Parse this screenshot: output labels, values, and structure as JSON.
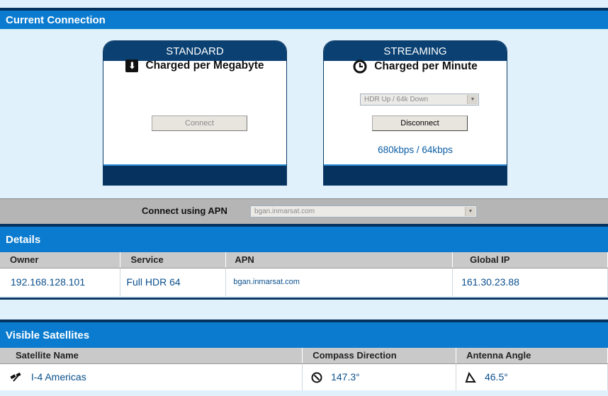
{
  "current_connection": {
    "title": "Current Connection",
    "standard": {
      "title": "STANDARD",
      "icon": "download-arrow-icon",
      "charge_label": "Charged per Megabyte",
      "connect_label": "Connect"
    },
    "streaming": {
      "title": "STREAMING",
      "icon": "clock-icon",
      "charge_label": "Charged per Minute",
      "rate_select": "HDR Up / 64k Down",
      "disconnect_label": "Disconnect",
      "rate_text": "680kbps / 64kbps"
    },
    "apn": {
      "label": "Connect using APN",
      "value": "bgan.inmarsat.com"
    }
  },
  "details": {
    "title": "Details",
    "columns": [
      "Owner",
      "Service",
      "APN",
      "Global IP"
    ],
    "row": {
      "owner": "192.168.128.101",
      "service": "Full HDR 64",
      "apn": "bgan.inmarsat.com",
      "global_ip": "161.30.23.88"
    }
  },
  "satellites": {
    "title": "Visible Satellites",
    "columns": [
      "Satellite Name",
      "Compass Direction",
      "Antenna Angle"
    ],
    "row": {
      "name": "I-4 Americas",
      "compass": "147.3°",
      "angle": "46.5°"
    }
  },
  "colors": {
    "header_blue": "#0a7bcf",
    "card_navy": "#0a4072",
    "value_blue": "#0a4f8c",
    "background": "#e0f1fb"
  }
}
